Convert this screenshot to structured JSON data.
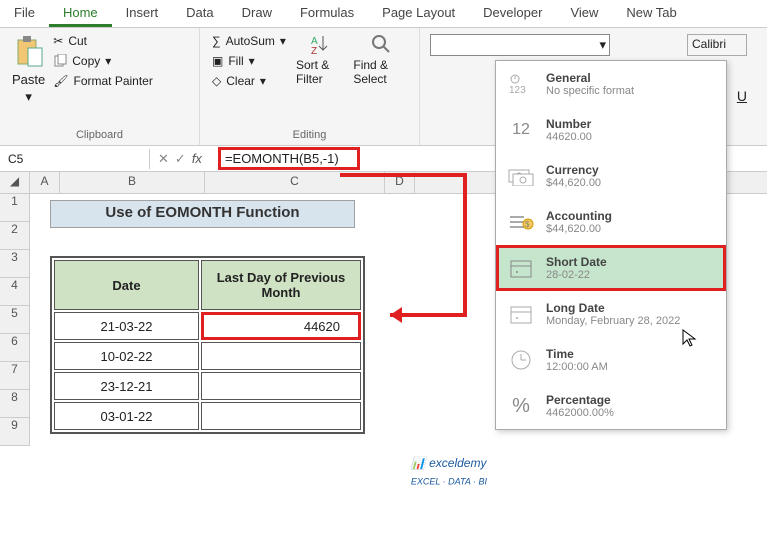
{
  "tabs": [
    "File",
    "Home",
    "Insert",
    "Data",
    "Draw",
    "Formulas",
    "Page Layout",
    "Developer",
    "View",
    "New Tab"
  ],
  "ribbon": {
    "clipboard": {
      "paste": "Paste",
      "cut": "Cut",
      "copy": "Copy",
      "format_painter": "Format Painter",
      "label": "Clipboard"
    },
    "editing": {
      "autosum": "AutoSum",
      "fill": "Fill",
      "clear": "Clear",
      "sort": "Sort & Filter",
      "find": "Find & Select",
      "label": "Editing"
    },
    "font_name": "Calibri",
    "underline": "U"
  },
  "namebox": "C5",
  "formula": "=EOMONTH(B5,-1)",
  "columns": [
    "A",
    "B",
    "C",
    "D"
  ],
  "rows": [
    "1",
    "2",
    "3",
    "4",
    "5",
    "6",
    "7",
    "8",
    "9"
  ],
  "sheet": {
    "title": "Use of EOMONTH Function",
    "headers": {
      "date": "Date",
      "last": "Last Day of Previous Month"
    },
    "data": [
      {
        "date": "21-03-22",
        "val": "44620"
      },
      {
        "date": "10-02-22",
        "val": ""
      },
      {
        "date": "23-12-21",
        "val": ""
      },
      {
        "date": "03-01-22",
        "val": ""
      }
    ]
  },
  "dropdown": [
    {
      "icon": "123",
      "name": "General",
      "sub": "No specific format"
    },
    {
      "icon": "12",
      "name": "Number",
      "sub": "44620.00"
    },
    {
      "icon": "$",
      "name": "Currency",
      "sub": "$44,620.00"
    },
    {
      "icon": "≡$",
      "name": "Accounting",
      "sub": "$44,620.00"
    },
    {
      "icon": "📅",
      "name": "Short Date",
      "sub": "28-02-22"
    },
    {
      "icon": "📅",
      "name": "Long Date",
      "sub": "Monday, February 28, 2022"
    },
    {
      "icon": "🕐",
      "name": "Time",
      "sub": "12:00:00 AM"
    },
    {
      "icon": "%",
      "name": "Percentage",
      "sub": "4462000.00%"
    }
  ],
  "watermark": "exceldemy"
}
